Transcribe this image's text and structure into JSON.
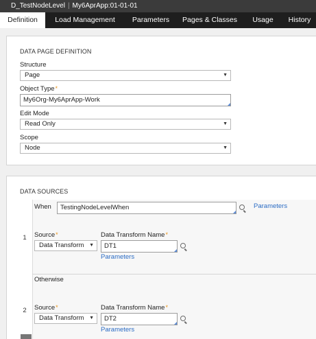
{
  "window": {
    "rule_name": "D_TestNodeLevel",
    "ruleset": "My6AprApp:01-01-01"
  },
  "tabs": [
    {
      "label": "Definition",
      "active": true
    },
    {
      "label": "Load Management",
      "active": false
    },
    {
      "label": "Parameters",
      "active": false
    },
    {
      "label": "Pages & Classes",
      "active": false
    },
    {
      "label": "Usage",
      "active": false
    },
    {
      "label": "History",
      "active": false
    }
  ],
  "definition": {
    "section_title": "DATA PAGE DEFINITION",
    "structure": {
      "label": "Structure",
      "value": "Page"
    },
    "object_type": {
      "label": "Object Type",
      "required_mark": "*",
      "value": "My6Org-My6AprApp-Work"
    },
    "edit_mode": {
      "label": "Edit Mode",
      "value": "Read Only"
    },
    "scope": {
      "label": "Scope",
      "value": "Node"
    }
  },
  "data_sources": {
    "section_title": "DATA SOURCES",
    "rows": [
      {
        "number": "1",
        "when_label": "When",
        "when_value": "TestingNodeLevelWhen",
        "when_parameters_link": "Parameters",
        "source_label": "Source",
        "source_value": "Data Transform",
        "dt_name_label": "Data Transform Name",
        "dt_name_value": "DT1",
        "parameters_link": "Parameters"
      },
      {
        "number": "2",
        "otherwise_label": "Otherwise",
        "source_label": "Source",
        "source_value": "Data Transform",
        "dt_name_label": "Data Transform Name",
        "dt_name_value": "DT2",
        "parameters_link": "Parameters"
      }
    ]
  },
  "icons": {
    "dropdown": "caret-down-icon",
    "lookup": "search-icon",
    "required": "asterisk-icon"
  },
  "colors": {
    "tab_bar": "#1e1e1e",
    "title_bar": "#3b3b3b",
    "link": "#2b6cc4",
    "required": "#e8931a"
  }
}
